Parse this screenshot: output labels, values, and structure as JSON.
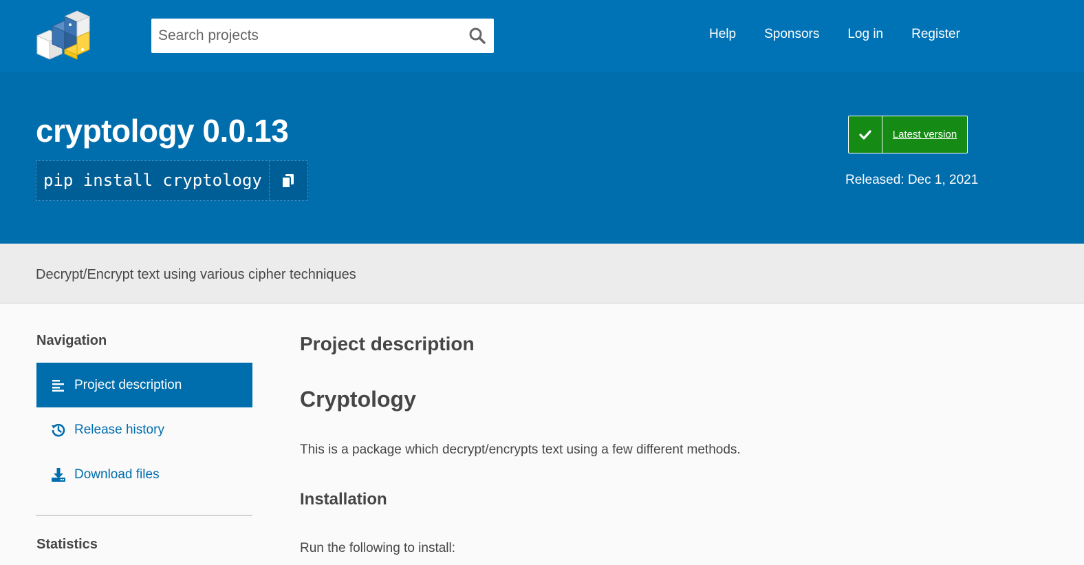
{
  "header": {
    "search_placeholder": "Search projects",
    "nav": [
      "Help",
      "Sponsors",
      "Log in",
      "Register"
    ]
  },
  "banner": {
    "title": "cryptology 0.0.13",
    "pip_command": "pip install cryptology",
    "latest_label": "Latest version",
    "released": "Released: Dec 1, 2021"
  },
  "summary": "Decrypt/Encrypt text using various cipher techniques",
  "sidebar": {
    "heading": "Navigation",
    "items": [
      {
        "label": "Project description",
        "icon": "align-left-icon",
        "active": true
      },
      {
        "label": "Release history",
        "icon": "history-icon",
        "active": false
      },
      {
        "label": "Download files",
        "icon": "download-icon",
        "active": false
      }
    ],
    "stats_heading": "Statistics"
  },
  "main": {
    "section_title": "Project description",
    "readme_title": "Cryptology",
    "intro": "This is a package which decrypt/encrypts text using a few different methods.",
    "install_heading": "Installation",
    "install_text": "Run the following to install:"
  },
  "colors": {
    "header_blue": "#0073b7",
    "banner_blue": "#006dad",
    "latest_green": "#158b15",
    "summary_gray": "#ececec"
  }
}
